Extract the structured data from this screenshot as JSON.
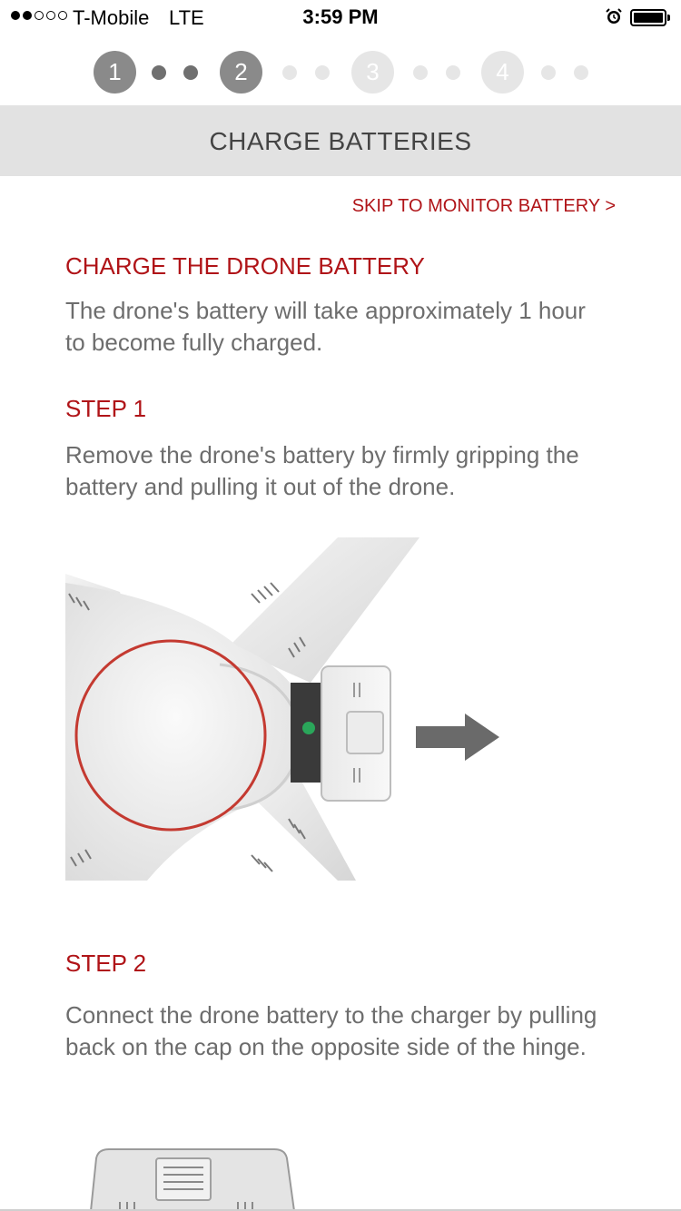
{
  "status_bar": {
    "carrier": "T-Mobile",
    "network": "LTE",
    "time": "3:59 PM",
    "signal_bars_filled": 2,
    "signal_bars_total": 5
  },
  "stepper": {
    "steps": [
      {
        "label": "1",
        "state": "done"
      },
      {
        "label": "2",
        "state": "done"
      },
      {
        "label": "3",
        "state": "todo"
      },
      {
        "label": "4",
        "state": "todo"
      }
    ]
  },
  "header": {
    "title": "CHARGE BATTERIES"
  },
  "skip_link": "SKIP TO MONITOR BATTERY >",
  "section": {
    "heading": "CHARGE THE DRONE BATTERY",
    "intro": "The drone's battery will take approximately 1 hour to become fully charged."
  },
  "step1": {
    "heading": "STEP 1",
    "text": "Remove the drone's battery by firmly gripping the battery and pulling it out of the drone."
  },
  "step2": {
    "heading": "STEP 2",
    "text": "Connect the drone battery to the charger by pulling back on the cap on the opposite side of the hinge."
  },
  "colors": {
    "accent_red": "#b01418",
    "header_bg": "#e2e2e2",
    "step_done": "#8a8a8a",
    "step_todo": "#e6e6e6"
  }
}
